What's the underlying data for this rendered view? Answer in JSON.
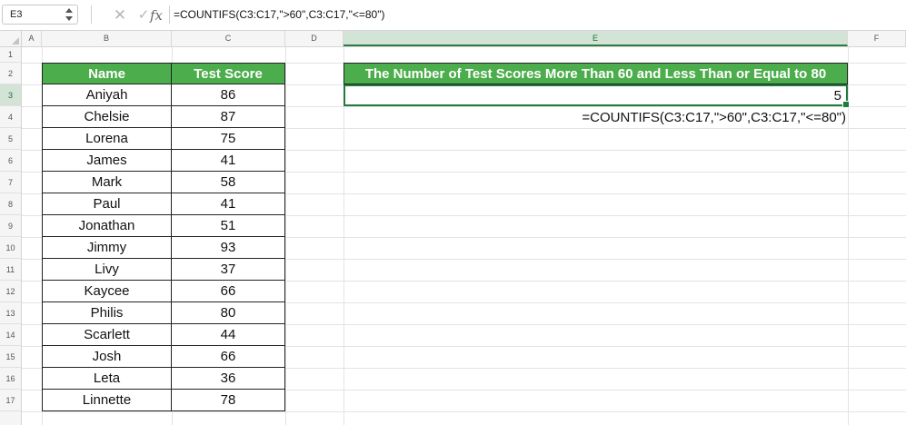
{
  "formula_bar": {
    "name_box": "E3",
    "cancel_icon": "cancel-icon",
    "enter_icon": "enter-icon",
    "fx_label": "fx",
    "formula": "=COUNTIFS(C3:C17,\">60\",C3:C17,\"<=80\")"
  },
  "columns": [
    "A",
    "B",
    "C",
    "D",
    "E",
    "F"
  ],
  "rows": [
    "1",
    "2",
    "3",
    "4",
    "5",
    "6",
    "7",
    "8",
    "9",
    "10",
    "11",
    "12",
    "13",
    "14",
    "15",
    "16",
    "17"
  ],
  "active_cell": {
    "column": "E",
    "row": "3"
  },
  "table": {
    "headers": {
      "name": "Name",
      "score": "Test Score"
    },
    "rows": [
      {
        "name": "Aniyah",
        "score": "86"
      },
      {
        "name": "Chelsie",
        "score": "87"
      },
      {
        "name": "Lorena",
        "score": "75"
      },
      {
        "name": "James",
        "score": "41"
      },
      {
        "name": "Mark",
        "score": "58"
      },
      {
        "name": "Paul",
        "score": "41"
      },
      {
        "name": "Jonathan",
        "score": "51"
      },
      {
        "name": "Jimmy",
        "score": "93"
      },
      {
        "name": "Livy",
        "score": "37"
      },
      {
        "name": "Kaycee",
        "score": "66"
      },
      {
        "name": "Philis",
        "score": "80"
      },
      {
        "name": "Scarlett",
        "score": "44"
      },
      {
        "name": "Josh",
        "score": "66"
      },
      {
        "name": "Leta",
        "score": "36"
      },
      {
        "name": "Linnette",
        "score": "78"
      }
    ]
  },
  "result": {
    "header": "The Number of Test Scores More Than 60 and Less Than or Equal to 80",
    "value": "5",
    "formula_note": "=COUNTIFS(C3:C17,\">60\",C3:C17,\"<=80\")"
  },
  "colors": {
    "header_green": "#4cad4c",
    "selection_green": "#1f7a3c"
  }
}
